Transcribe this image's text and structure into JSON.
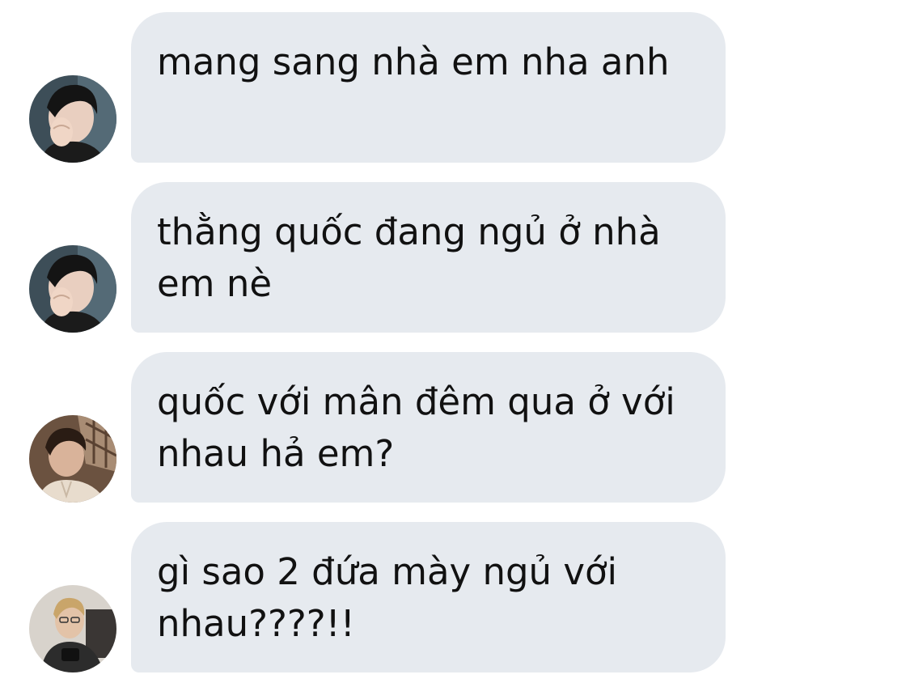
{
  "conversation": {
    "messages": [
      {
        "text": "mang sang nhà em nha anh",
        "avatar": "avatar-dark-hair-hand-over-mouth"
      },
      {
        "text": "thằng quốc đang ngủ ở nhà em nè",
        "avatar": "avatar-dark-hair-hand-over-mouth"
      },
      {
        "text": "quốc với mân đêm qua ở với nhau hả em?",
        "avatar": "avatar-reclining-plaid-background"
      },
      {
        "text": "gì sao 2 đứa mày ngủ với nhau????!!",
        "avatar": "avatar-blond-hair-glasses"
      }
    ]
  },
  "colors": {
    "bubble": "#e6eaef",
    "text": "#111111",
    "background": "#ffffff"
  }
}
